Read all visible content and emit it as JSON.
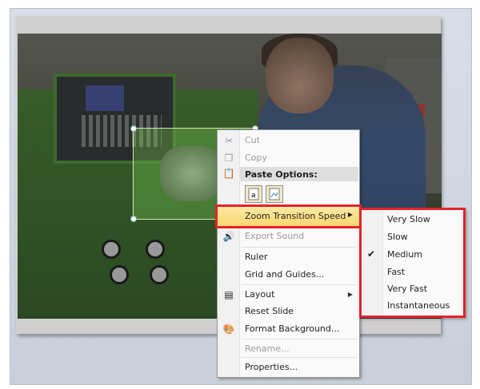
{
  "context_menu": {
    "cut": "Cut",
    "copy": "Copy",
    "paste_options": "Paste Options:",
    "zoom_transition_speed": "Zoom Transition Speed",
    "export_sound": "Export Sound",
    "ruler": "Ruler",
    "grid_and_guides": "Grid and Guides...",
    "layout": "Layout",
    "reset_slide": "Reset Slide",
    "format_background": "Format Background...",
    "rename": "Rename...",
    "properties": "Properties..."
  },
  "submenu": {
    "items": [
      "Very Slow",
      "Slow",
      "Medium",
      "Fast",
      "Very Fast",
      "Instantaneous"
    ],
    "checked": "Medium"
  },
  "colors": {
    "highlight_outline": "#e3232b",
    "menu_highlight": "#f9d76f"
  },
  "icons": [
    "scissors-icon",
    "copy-icon",
    "paste-icon",
    "paste-keep-text-icon",
    "paste-picture-icon",
    "export-sound-icon",
    "layout-icon",
    "format-background-icon",
    "submenu-arrow-icon",
    "checkmark-icon"
  ]
}
